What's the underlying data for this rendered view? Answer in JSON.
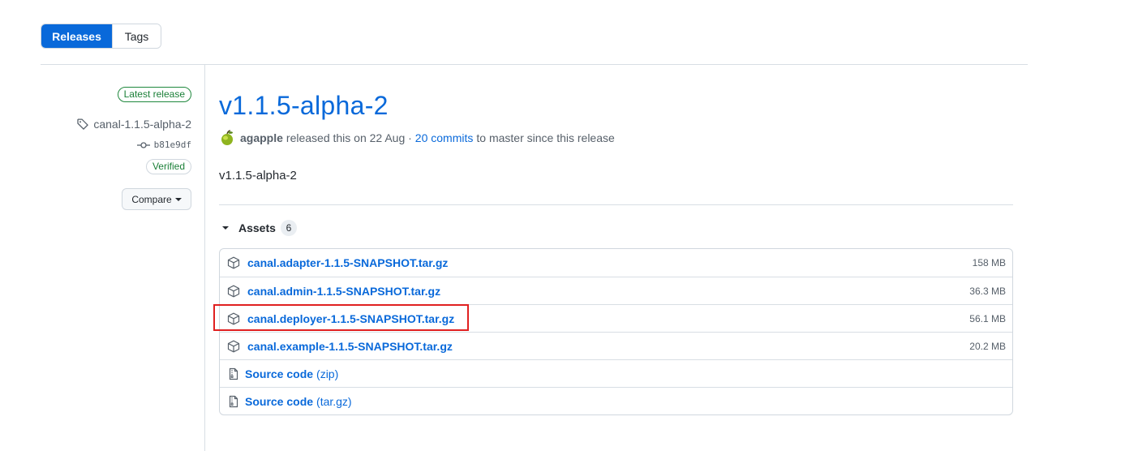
{
  "tabs": {
    "releases": "Releases",
    "tags": "Tags"
  },
  "sidebar": {
    "latest_badge": "Latest release",
    "tag_name": "canal-1.1.5-alpha-2",
    "commit_sha": "b81e9df",
    "verified": "Verified",
    "compare": "Compare"
  },
  "release": {
    "title": "v1.1.5-alpha-2",
    "author": "agapple",
    "released_text": "released this on 22 Aug ·",
    "commits_link": "20 commits",
    "since_text": "to master since this release",
    "body": "v1.1.5-alpha-2"
  },
  "assets": {
    "label": "Assets",
    "count": "6",
    "items": [
      {
        "name": "canal.adapter-1.1.5-SNAPSHOT.tar.gz",
        "size": "158 MB"
      },
      {
        "name": "canal.admin-1.1.5-SNAPSHOT.tar.gz",
        "size": "36.3 MB"
      },
      {
        "name": "canal.deployer-1.1.5-SNAPSHOT.tar.gz",
        "size": "56.1 MB"
      },
      {
        "name": "canal.example-1.1.5-SNAPSHOT.tar.gz",
        "size": "20.2 MB"
      }
    ],
    "source": [
      {
        "name": "Source code",
        "ext": "(zip)"
      },
      {
        "name": "Source code",
        "ext": "(tar.gz)"
      }
    ]
  },
  "colors": {
    "link": "#0969da",
    "verified_green": "#1a7f37",
    "highlight_box": "#e02020"
  },
  "icons": [
    "tag-icon",
    "commit-icon",
    "package-icon",
    "file-zip-icon",
    "caret-down-icon",
    "avatar-apple-icon"
  ]
}
